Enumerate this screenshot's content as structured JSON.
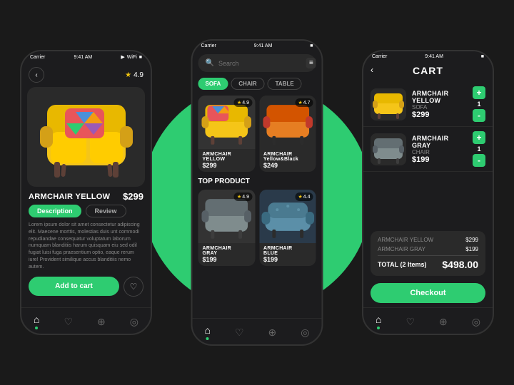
{
  "scene": {
    "bg_circle_color": "#2ecc71"
  },
  "left_phone": {
    "status_bar": {
      "carrier": "Carrier",
      "time": "9:41 AM",
      "battery": "■"
    },
    "rating": "4.9",
    "product_name": "ARMCHAIR YELLOW",
    "product_price": "$299",
    "tab_description": "Description",
    "tab_review": "Review",
    "description": "Lorem ipsum dolor sit amet consectetur adipiscing elit. Maecene morttis, molestias duis unt commodi repudiandae consequatur voluptatum laborum numquam blanditiis harum quisquam eiu sed odil fugiat luisi fuga praesentium optio, eaque rerum iure! Provident similique accus blanditiis nemo autem.",
    "add_to_cart": "Add to cart",
    "nav": {
      "home": "⌂",
      "heart": "♡",
      "bag": "🛍",
      "user": "👤"
    }
  },
  "mid_phone": {
    "status_bar": {
      "carrier": "Carrier",
      "time": "9:41 AM"
    },
    "search_placeholder": "Search",
    "categories": [
      "SOFA",
      "CHAIR",
      "TABLE"
    ],
    "active_category": "SOFA",
    "products": [
      {
        "name": "ARMCHAIR\nYELLOW",
        "price": "$299",
        "rating": "4.9",
        "color": "yellow"
      },
      {
        "name": "ARMCHAIR\nYellow&Black",
        "price": "$249",
        "rating": "4.7",
        "color": "orange"
      }
    ],
    "top_section": "TOP PRODUCT",
    "top_products": [
      {
        "name": "ARMCHAIR\nGRAY",
        "price": "$199",
        "rating": "4.9",
        "color": "gray"
      },
      {
        "name": "ARMCHAIR\nBLUE",
        "price": "$199",
        "rating": "4.4",
        "color": "blue"
      }
    ]
  },
  "right_phone": {
    "status_bar": {
      "carrier": "Carrier",
      "time": "9:41 AM"
    },
    "cart_title": "CART",
    "items": [
      {
        "name": "ARMCHAIR YELLOW",
        "type": "SOFA",
        "price": "$299",
        "qty": "1",
        "color": "yellow"
      },
      {
        "name": "ARMCHAIR GRAY",
        "type": "CHAIR",
        "price": "$199",
        "qty": "1",
        "color": "gray"
      }
    ],
    "summary": {
      "item1_label": "ARMCHAIR YELLOW",
      "item1_price": "$299",
      "item2_label": "ARMCHAIR GRAY",
      "item2_price": "$199",
      "total_label": "TOTAL (2 Items)",
      "total_value": "$498.00"
    },
    "checkout_btn": "Checkout",
    "nav": {
      "home": "⌂",
      "heart": "♡",
      "bag": "🛍",
      "user": "👤"
    }
  }
}
